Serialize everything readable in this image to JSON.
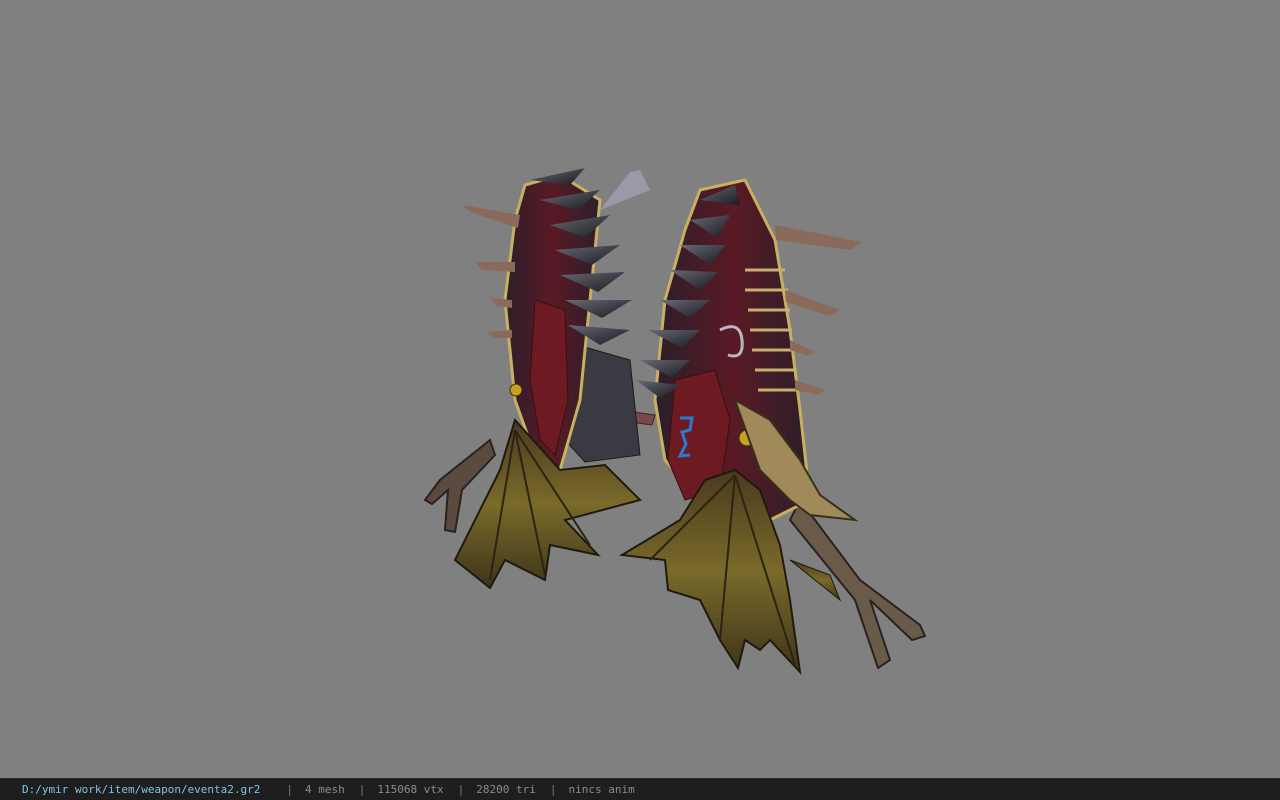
{
  "viewer": {
    "background_color": "#808080",
    "model_name": "eventa2.gr2"
  },
  "status_bar": {
    "file_path": "D:/ymir work/item/weapon/eventa2.gr2",
    "separator": "|",
    "mesh_count": "4 mesh",
    "vertex_count": "115068 vtx",
    "triangle_count": "28200 tri",
    "animation": "nincs anim",
    "path_color": "#7fc4e6",
    "text_color": "#8c8c8c"
  }
}
